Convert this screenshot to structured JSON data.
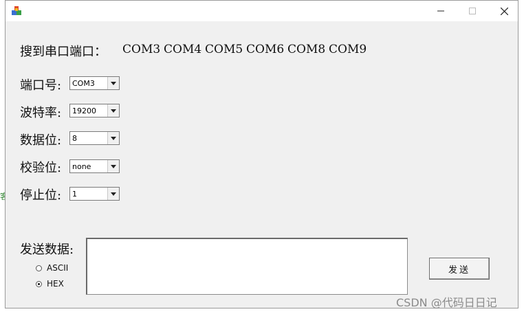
{
  "window": {
    "controls": {
      "minimize": "─",
      "maximize": "☐",
      "close": "✕"
    }
  },
  "found": {
    "label": "搜到串口端口：",
    "ports": [
      "COM3",
      "COM4",
      "COM5",
      "COM6",
      "COM8",
      "COM9"
    ]
  },
  "fields": {
    "port": {
      "label": "端口号:",
      "value": "COM3"
    },
    "baud": {
      "label": "波特率:",
      "value": "19200"
    },
    "databits": {
      "label": "数据位:",
      "value": "8"
    },
    "parity": {
      "label": "校验位:",
      "value": "none"
    },
    "stopbits": {
      "label": "停止位:",
      "value": "1"
    }
  },
  "send": {
    "label": "发送数据:",
    "mode_ascii": "ASCII",
    "mode_hex": "HEX",
    "selected_mode": "HEX",
    "text": "",
    "button": "发送"
  },
  "watermark": "CSDN @代码日日记"
}
